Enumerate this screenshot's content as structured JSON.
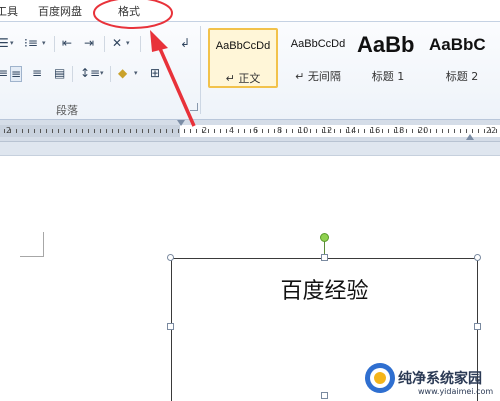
{
  "tabs": [
    {
      "label": "工具"
    },
    {
      "label": "百度网盘"
    },
    {
      "label": "格式"
    }
  ],
  "ribbon": {
    "paragraph_group_label": "段落"
  },
  "styles": [
    {
      "preview": "AaBbCcDd",
      "name": "正文",
      "selected": true
    },
    {
      "preview": "AaBbCcDd",
      "name": "无间隔",
      "selected": false
    },
    {
      "preview": "AaBb",
      "name": "标题 1",
      "selected": false
    },
    {
      "preview": "AaBbC",
      "name": "标题 2",
      "selected": false
    }
  ],
  "ruler": {
    "labels": [
      "2",
      "2",
      "4",
      "6",
      "8",
      "10",
      "12",
      "14",
      "16",
      "18",
      "20",
      "22"
    ]
  },
  "document": {
    "textbox_text": "百度经验"
  },
  "annotation": {
    "color": "#e8323a"
  },
  "watermark": {
    "text": "纯净系统家园",
    "url": "www.yidaimei.com"
  }
}
